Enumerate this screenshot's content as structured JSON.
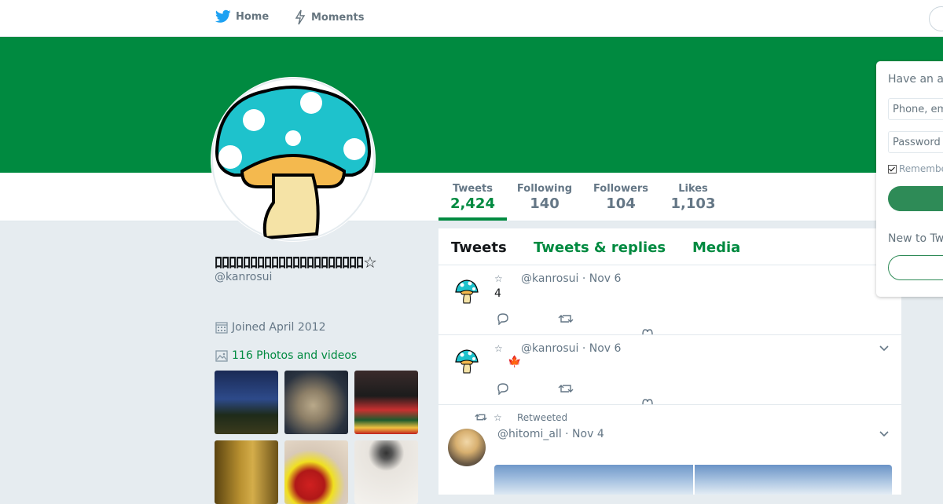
{
  "nav": {
    "home_label": "Home",
    "moments_label": "Moments"
  },
  "colors": {
    "brand": "#008a40",
    "twitter_blue": "#1da1f2"
  },
  "profile": {
    "name": "ﾛﾛﾛﾛﾛﾛﾛﾛﾛﾛﾛﾛﾛﾛﾛﾛﾛﾛﾛﾛﾛ☆",
    "handle": "@kanrosui",
    "joined": "Joined April 2012",
    "photos_link": "116 Photos and videos"
  },
  "stats": [
    {
      "label": "Tweets",
      "value": "2,424"
    },
    {
      "label": "Following",
      "value": "140"
    },
    {
      "label": "Followers",
      "value": "104"
    },
    {
      "label": "Likes",
      "value": "1,103"
    }
  ],
  "timeline": {
    "tabs": [
      "Tweets",
      "Tweets & replies",
      "Media"
    ],
    "tweets": [
      {
        "star": "☆",
        "meta": "@kanrosui · Nov 6",
        "text": "4"
      },
      {
        "star": "☆",
        "meta": "@kanrosui · Nov 6",
        "text": "🍁"
      },
      {
        "retweet_label": "Retweeted",
        "star": "☆",
        "meta": "@hitomi_all · Nov 4"
      }
    ]
  },
  "login": {
    "heading": "Have an account?",
    "phone_placeholder": "Phone, email or username",
    "password_placeholder": "Password",
    "remember": "Remember me",
    "new_to": "New to Twitter?"
  }
}
